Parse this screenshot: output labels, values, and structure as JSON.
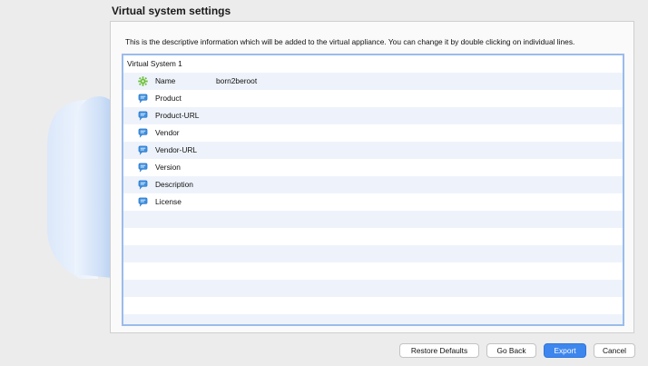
{
  "page": {
    "title": "Virtual system settings",
    "description": "This is the descriptive information which will be added to the virtual appliance. You can change it by double clicking on individual lines."
  },
  "tree": {
    "root_label": "Virtual System 1",
    "items": [
      {
        "label": "Name",
        "value": "born2beroot",
        "icon": "gear-icon"
      },
      {
        "label": "Product",
        "value": "",
        "icon": "speech-bubble-icon"
      },
      {
        "label": "Product-URL",
        "value": "",
        "icon": "speech-bubble-icon"
      },
      {
        "label": "Vendor",
        "value": "",
        "icon": "speech-bubble-icon"
      },
      {
        "label": "Vendor-URL",
        "value": "",
        "icon": "speech-bubble-icon"
      },
      {
        "label": "Version",
        "value": "",
        "icon": "speech-bubble-icon"
      },
      {
        "label": "Description",
        "value": "",
        "icon": "speech-bubble-icon"
      },
      {
        "label": "License",
        "value": "",
        "icon": "speech-bubble-icon"
      }
    ]
  },
  "buttons": {
    "restore_defaults": "Restore Defaults",
    "go_back": "Go Back",
    "export": "Export",
    "cancel": "Cancel"
  },
  "colors": {
    "accent": "#3d86ee",
    "selection_border": "#9bbcea",
    "row_alt": "#eef3fb"
  }
}
